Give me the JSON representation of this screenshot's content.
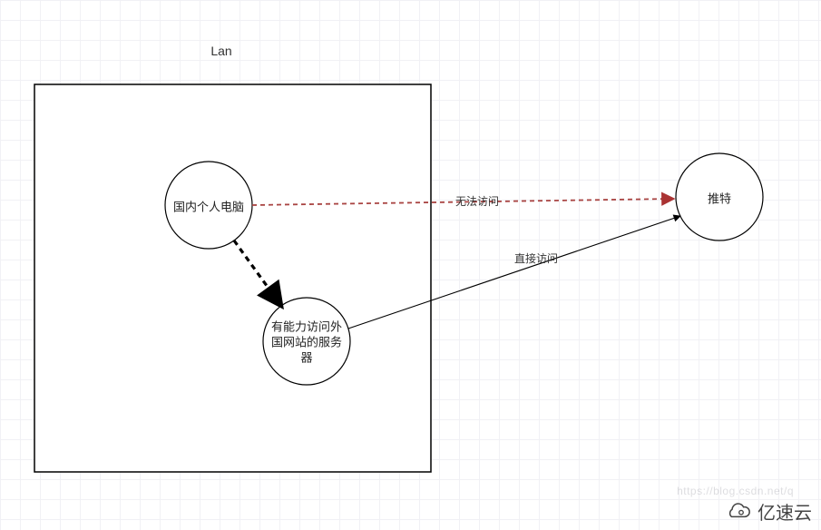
{
  "diagram": {
    "lan_box_title": "Lan",
    "nodes": {
      "pc": {
        "label": "国内个人电脑"
      },
      "proxy": {
        "line1": "有能力访问外",
        "line2": "国网站的服务",
        "line3": "器"
      },
      "twitter": {
        "label": "推特"
      }
    },
    "edges": {
      "blocked": {
        "label": "无法访问"
      },
      "direct": {
        "label": "直接访问"
      }
    }
  },
  "watermark": {
    "brand": "亿速云",
    "faded_url": "https://blog.csdn.net/q"
  }
}
